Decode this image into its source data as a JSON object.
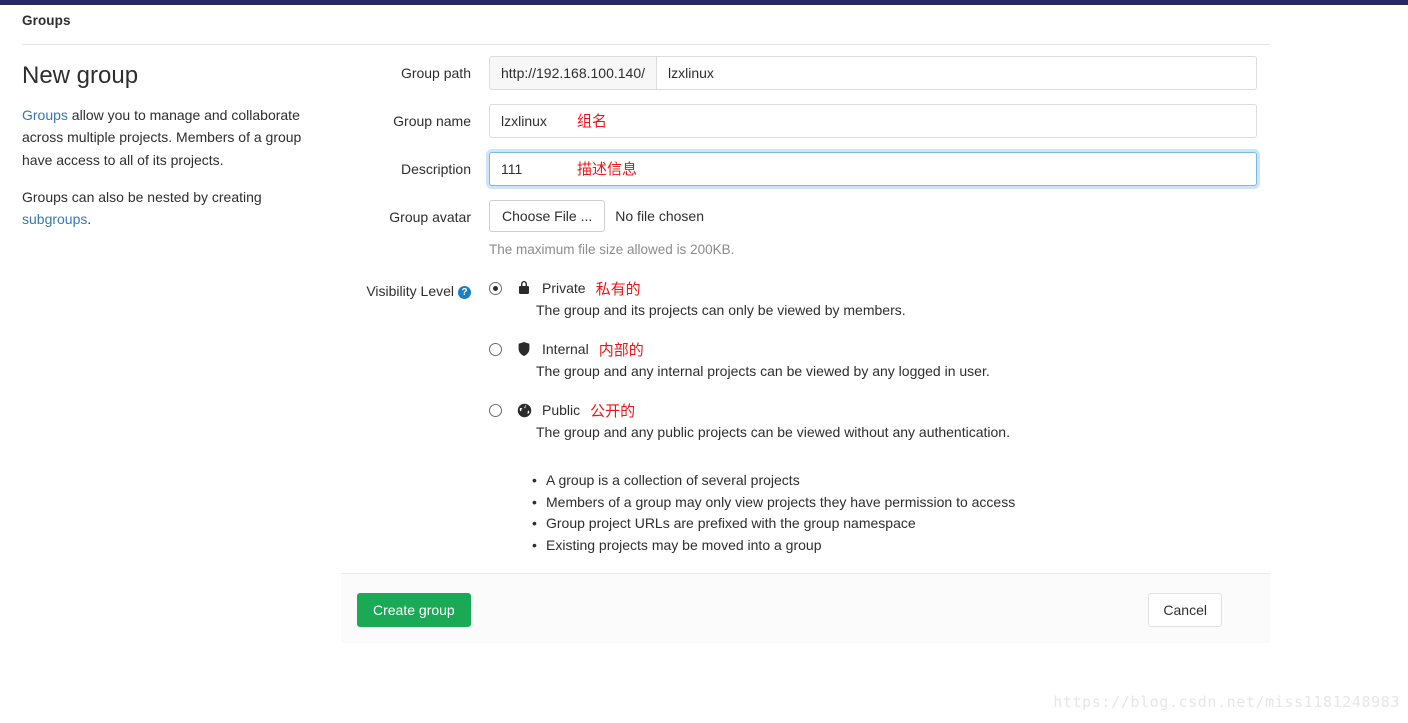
{
  "topbar": {
    "color": "#292961"
  },
  "breadcrumb": {
    "label": "Groups"
  },
  "intro": {
    "title": "New group",
    "paragraph1_link": "Groups",
    "paragraph1_rest": " allow you to manage and collaborate across multiple projects. Members of a group have access to all of its projects.",
    "paragraph2_pre": "Groups can also be nested by creating ",
    "paragraph2_link": "subgroups",
    "paragraph2_post": "."
  },
  "form": {
    "group_path": {
      "label": "Group path",
      "prefix": "http://192.168.100.140/",
      "value": "lzxlinux",
      "placeholder": ""
    },
    "group_name": {
      "label": "Group name",
      "value": "lzxlinux",
      "placeholder": "",
      "annotation": "组名"
    },
    "description": {
      "label": "Description",
      "value": "111",
      "placeholder": "",
      "annotation": "描述信息",
      "focused": true
    },
    "group_avatar": {
      "label": "Group avatar",
      "choose_button": "Choose File ...",
      "no_file_text": "No file chosen",
      "help_text": "The maximum file size allowed is 200KB."
    },
    "visibility": {
      "label": "Visibility Level",
      "help_icon": "question-mark-icon",
      "options": [
        {
          "name": "Private",
          "annotation": "私有的",
          "icon": "lock-icon",
          "selected": true,
          "description": "The group and its projects can only be viewed by members."
        },
        {
          "name": "Internal",
          "annotation": "内部的",
          "icon": "shield-icon",
          "selected": false,
          "description": "The group and any internal projects can be viewed by any logged in user."
        },
        {
          "name": "Public",
          "annotation": "公开的",
          "icon": "globe-icon",
          "selected": false,
          "description": "The group and any public projects can be viewed without any authentication."
        }
      ]
    },
    "bullets": [
      "A group is a collection of several projects",
      "Members of a group may only view projects they have permission to access",
      "Group project URLs are prefixed with the group namespace",
      "Existing projects may be moved into a group"
    ]
  },
  "footer": {
    "create_label": "Create group",
    "create_color": "#1aaa55",
    "cancel_label": "Cancel"
  },
  "watermark": {
    "text": "https://blog.csdn.net/miss1181248983"
  }
}
